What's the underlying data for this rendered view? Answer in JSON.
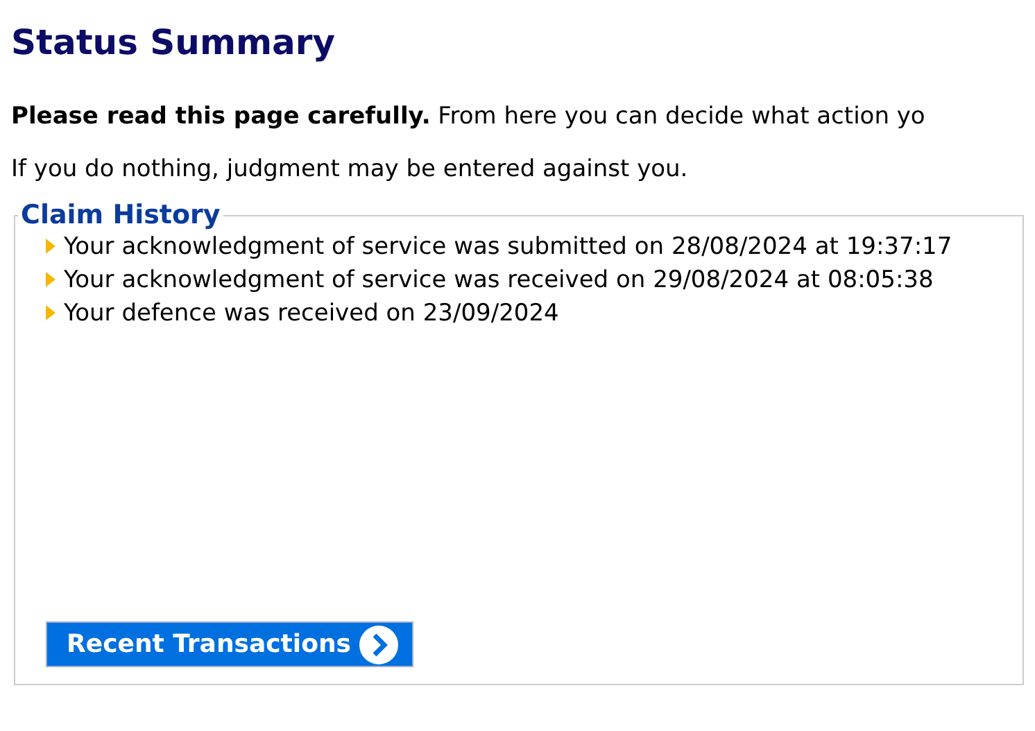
{
  "title": "Status Summary",
  "intro": "**Please read this page carefully.** From here you can decide what action yo",
  "warning": "If you do nothing, judgment may be entered against you.",
  "claim_history": {
    "legend": "Claim History",
    "items": [
      "Your acknowledgment of service was submitted on 28/08/2024 at 19:37:17",
      "Your acknowledgment of service was received on 29/08/2024 at 08:05:38",
      "Your defence was received on 23/09/2024"
    ],
    "button": "Recent Transactions"
  }
}
